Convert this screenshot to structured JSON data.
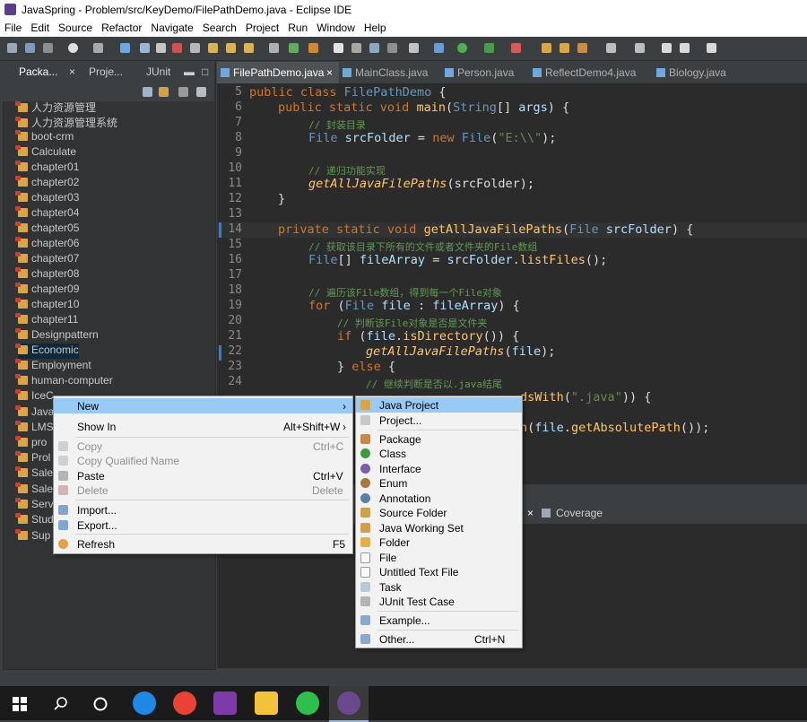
{
  "window": {
    "title": "JavaSpring - Problem/src/KeyDemo/FilePathDemo.java - Eclipse IDE"
  },
  "menubar": [
    "File",
    "Edit",
    "Source",
    "Refactor",
    "Navigate",
    "Search",
    "Project",
    "Run",
    "Window",
    "Help"
  ],
  "left_tabs": [
    "Packa...",
    "Proje...",
    "JUnit"
  ],
  "tree": [
    "人力资源管理",
    "人力资源管理系统",
    "boot-crm",
    "Calculate",
    "chapter01",
    "chapter02",
    "chapter03",
    "chapter04",
    "chapter05",
    "chapter06",
    "chapter07",
    "chapter08",
    "chapter09",
    "chapter10",
    "chapter11",
    "Designpattern",
    "Economic",
    "Employment",
    "human-computer",
    "IceC",
    "Java",
    "LMS",
    "pro",
    "Prol",
    "Sale",
    "Sale",
    "Serv",
    "Stud",
    "Sup"
  ],
  "editor_tabs": [
    "FilePathDemo.java",
    "MainClass.java",
    "Person.java",
    "ReflectDemo4.java",
    "Biology.java"
  ],
  "line_numbers": [
    "5",
    "6",
    "7",
    "8",
    "9",
    "10",
    "11",
    "12",
    "13",
    "14",
    "15",
    "16",
    "17",
    "18",
    "19",
    "20",
    "21",
    "22",
    "23",
    "24"
  ],
  "code": {
    "l5": [
      "public class ",
      "FilePathDemo",
      " {"
    ],
    "l6": [
      "public static void ",
      "main",
      "(",
      "String",
      "[] ",
      "args",
      ") {"
    ],
    "l7": "// 封装目录",
    "l8": [
      "File",
      " srcFolder",
      " = ",
      "new ",
      "File",
      "(",
      "\"E:\\\\\"",
      ");"
    ],
    "l10": "// 递归功能实现",
    "l11": [
      "getAllJavaFilePaths",
      "(srcFolder);"
    ],
    "l12": "}",
    "l14": [
      "private static void ",
      "getAllJavaFilePaths",
      "(",
      "File",
      " srcFolder",
      ") {"
    ],
    "l15": "// 获取该目录下所有的文件或者文件夹的File数组",
    "l16": [
      "File",
      "[] ",
      "fileArray",
      " = ",
      "srcFolder",
      ".",
      "listFiles",
      "();"
    ],
    "l18": "// 遍历该File数组，得到每一个File对象",
    "l19": [
      "for ",
      "(",
      "File",
      " file",
      " : ",
      "fileArray",
      ") {"
    ],
    "l20": "// 判断该File对象是否是文件夹",
    "l21": [
      "if ",
      "(",
      "file",
      ".",
      "isDirectory",
      "()) {"
    ],
    "l22": [
      "getAllJavaFilePaths",
      "(",
      "file",
      ");"
    ],
    "l23": [
      "} ",
      "else ",
      "{"
    ],
    "l24": "// 继续判断是否以.java结尾",
    "l25_tail": [
      "dsWith",
      "(",
      "\".java\"",
      ")) {"
    ],
    "l27_tail": [
      "n",
      "(",
      "file",
      ".",
      "getAbsolutePath",
      "());"
    ]
  },
  "lower_tabs": {
    "coverage": "Coverage"
  },
  "context_menu": [
    {
      "label": "New",
      "accel": "",
      "submenu": true,
      "highlight": true
    },
    {
      "label": "Show In",
      "accel": "Alt+Shift+W"
    },
    {
      "label": "Copy",
      "accel": "Ctrl+C",
      "disabled": true
    },
    {
      "label": "Copy Qualified Name",
      "accel": "",
      "disabled": true
    },
    {
      "label": "Paste",
      "accel": "Ctrl+V"
    },
    {
      "label": "Delete",
      "accel": "Delete",
      "disabled": true
    },
    {
      "label": "Import...",
      "accel": ""
    },
    {
      "label": "Export...",
      "accel": ""
    },
    {
      "label": "Refresh",
      "accel": "F5"
    }
  ],
  "submenu": [
    {
      "label": "Java Project",
      "highlight": true
    },
    {
      "label": "Project..."
    },
    {
      "label": "Package"
    },
    {
      "label": "Class"
    },
    {
      "label": "Interface"
    },
    {
      "label": "Enum"
    },
    {
      "label": "Annotation"
    },
    {
      "label": "Source Folder"
    },
    {
      "label": "Java Working Set"
    },
    {
      "label": "Folder"
    },
    {
      "label": "File"
    },
    {
      "label": "Untitled Text File"
    },
    {
      "label": "Task"
    },
    {
      "label": "JUnit Test Case"
    },
    {
      "label": "Example..."
    },
    {
      "label": "Other...",
      "accel": "Ctrl+N"
    }
  ]
}
